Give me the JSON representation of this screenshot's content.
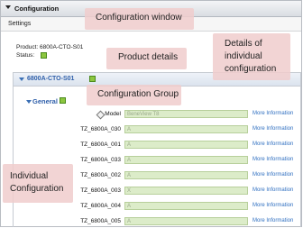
{
  "window": {
    "title": "Configuration"
  },
  "menu": {
    "settings": "Settings"
  },
  "product": {
    "line": "Product: 6800A-CTO-S01",
    "status_label": "Status:",
    "status_color": "#8cc63f"
  },
  "group": {
    "name": "6800A-CTO-S01"
  },
  "section": {
    "name": "General"
  },
  "more_info": "More Information",
  "rows": [
    {
      "label": "Model",
      "value": "BeneView T8",
      "has_diamond": true
    },
    {
      "label": "TZ_6800A_030",
      "value": "A"
    },
    {
      "label": "TZ_6800A_001",
      "value": "A"
    },
    {
      "label": "TZ_6800A_033",
      "value": "A"
    },
    {
      "label": "TZ_6800A_002",
      "value": "A"
    },
    {
      "label": "TZ_6800A_003",
      "value": "X"
    },
    {
      "label": "TZ_6800A_004",
      "value": "A"
    },
    {
      "label": "TZ_6800A_005",
      "value": "A"
    }
  ],
  "callouts": {
    "config_window": "Configuration window",
    "product_details": "Product details",
    "config_group": "Configuration Group",
    "details_line1": "Details of",
    "details_line2": "individual",
    "details_line3": "configuration",
    "indiv_line1": "Individual",
    "indiv_line2": "Configuration"
  }
}
